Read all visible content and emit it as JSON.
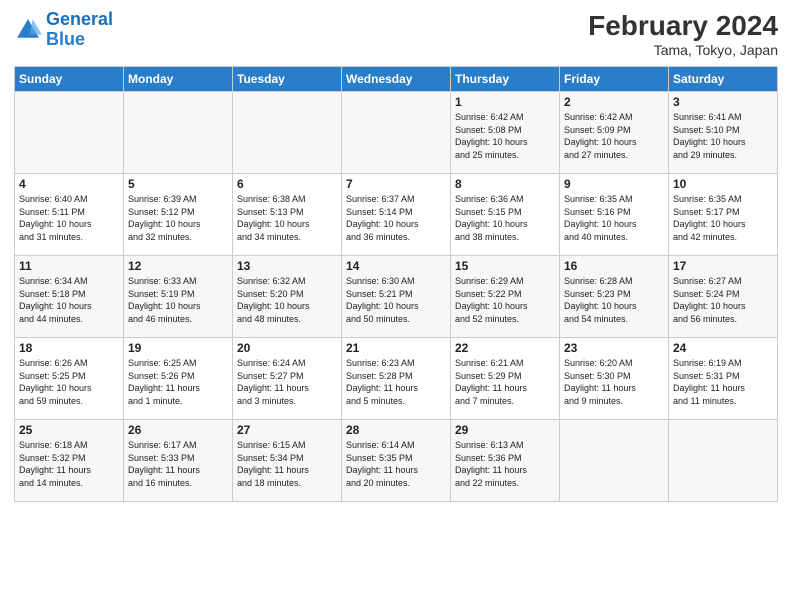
{
  "header": {
    "logo_line1": "General",
    "logo_line2": "Blue",
    "title": "February 2024",
    "subtitle": "Tama, Tokyo, Japan"
  },
  "columns": [
    "Sunday",
    "Monday",
    "Tuesday",
    "Wednesday",
    "Thursday",
    "Friday",
    "Saturday"
  ],
  "weeks": [
    [
      {
        "day": "",
        "info": ""
      },
      {
        "day": "",
        "info": ""
      },
      {
        "day": "",
        "info": ""
      },
      {
        "day": "",
        "info": ""
      },
      {
        "day": "1",
        "info": "Sunrise: 6:42 AM\nSunset: 5:08 PM\nDaylight: 10 hours\nand 25 minutes."
      },
      {
        "day": "2",
        "info": "Sunrise: 6:42 AM\nSunset: 5:09 PM\nDaylight: 10 hours\nand 27 minutes."
      },
      {
        "day": "3",
        "info": "Sunrise: 6:41 AM\nSunset: 5:10 PM\nDaylight: 10 hours\nand 29 minutes."
      }
    ],
    [
      {
        "day": "4",
        "info": "Sunrise: 6:40 AM\nSunset: 5:11 PM\nDaylight: 10 hours\nand 31 minutes."
      },
      {
        "day": "5",
        "info": "Sunrise: 6:39 AM\nSunset: 5:12 PM\nDaylight: 10 hours\nand 32 minutes."
      },
      {
        "day": "6",
        "info": "Sunrise: 6:38 AM\nSunset: 5:13 PM\nDaylight: 10 hours\nand 34 minutes."
      },
      {
        "day": "7",
        "info": "Sunrise: 6:37 AM\nSunset: 5:14 PM\nDaylight: 10 hours\nand 36 minutes."
      },
      {
        "day": "8",
        "info": "Sunrise: 6:36 AM\nSunset: 5:15 PM\nDaylight: 10 hours\nand 38 minutes."
      },
      {
        "day": "9",
        "info": "Sunrise: 6:35 AM\nSunset: 5:16 PM\nDaylight: 10 hours\nand 40 minutes."
      },
      {
        "day": "10",
        "info": "Sunrise: 6:35 AM\nSunset: 5:17 PM\nDaylight: 10 hours\nand 42 minutes."
      }
    ],
    [
      {
        "day": "11",
        "info": "Sunrise: 6:34 AM\nSunset: 5:18 PM\nDaylight: 10 hours\nand 44 minutes."
      },
      {
        "day": "12",
        "info": "Sunrise: 6:33 AM\nSunset: 5:19 PM\nDaylight: 10 hours\nand 46 minutes."
      },
      {
        "day": "13",
        "info": "Sunrise: 6:32 AM\nSunset: 5:20 PM\nDaylight: 10 hours\nand 48 minutes."
      },
      {
        "day": "14",
        "info": "Sunrise: 6:30 AM\nSunset: 5:21 PM\nDaylight: 10 hours\nand 50 minutes."
      },
      {
        "day": "15",
        "info": "Sunrise: 6:29 AM\nSunset: 5:22 PM\nDaylight: 10 hours\nand 52 minutes."
      },
      {
        "day": "16",
        "info": "Sunrise: 6:28 AM\nSunset: 5:23 PM\nDaylight: 10 hours\nand 54 minutes."
      },
      {
        "day": "17",
        "info": "Sunrise: 6:27 AM\nSunset: 5:24 PM\nDaylight: 10 hours\nand 56 minutes."
      }
    ],
    [
      {
        "day": "18",
        "info": "Sunrise: 6:26 AM\nSunset: 5:25 PM\nDaylight: 10 hours\nand 59 minutes."
      },
      {
        "day": "19",
        "info": "Sunrise: 6:25 AM\nSunset: 5:26 PM\nDaylight: 11 hours\nand 1 minute."
      },
      {
        "day": "20",
        "info": "Sunrise: 6:24 AM\nSunset: 5:27 PM\nDaylight: 11 hours\nand 3 minutes."
      },
      {
        "day": "21",
        "info": "Sunrise: 6:23 AM\nSunset: 5:28 PM\nDaylight: 11 hours\nand 5 minutes."
      },
      {
        "day": "22",
        "info": "Sunrise: 6:21 AM\nSunset: 5:29 PM\nDaylight: 11 hours\nand 7 minutes."
      },
      {
        "day": "23",
        "info": "Sunrise: 6:20 AM\nSunset: 5:30 PM\nDaylight: 11 hours\nand 9 minutes."
      },
      {
        "day": "24",
        "info": "Sunrise: 6:19 AM\nSunset: 5:31 PM\nDaylight: 11 hours\nand 11 minutes."
      }
    ],
    [
      {
        "day": "25",
        "info": "Sunrise: 6:18 AM\nSunset: 5:32 PM\nDaylight: 11 hours\nand 14 minutes."
      },
      {
        "day": "26",
        "info": "Sunrise: 6:17 AM\nSunset: 5:33 PM\nDaylight: 11 hours\nand 16 minutes."
      },
      {
        "day": "27",
        "info": "Sunrise: 6:15 AM\nSunset: 5:34 PM\nDaylight: 11 hours\nand 18 minutes."
      },
      {
        "day": "28",
        "info": "Sunrise: 6:14 AM\nSunset: 5:35 PM\nDaylight: 11 hours\nand 20 minutes."
      },
      {
        "day": "29",
        "info": "Sunrise: 6:13 AM\nSunset: 5:36 PM\nDaylight: 11 hours\nand 22 minutes."
      },
      {
        "day": "",
        "info": ""
      },
      {
        "day": "",
        "info": ""
      }
    ]
  ]
}
